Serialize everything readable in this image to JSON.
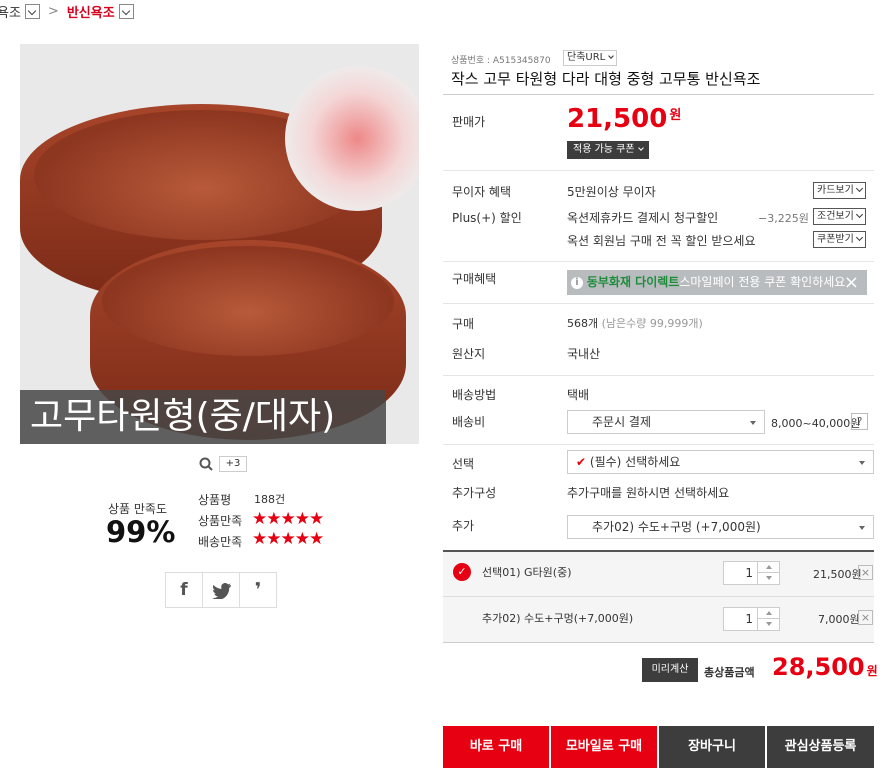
{
  "breadcrumb": {
    "parent": "욕조",
    "current": "반신욕조",
    "separator": ">"
  },
  "image": {
    "overlay_text": "고무타원형(중/대자)",
    "more_count": "+3"
  },
  "rating": {
    "satisfaction_label": "상품 만족도",
    "satisfaction_value": "99%",
    "review_label": "상품평",
    "review_count": "188건",
    "product_label": "상품만족",
    "delivery_label": "배송만족",
    "stars": "★★★★★",
    "product_stars": 5,
    "delivery_stars": 5
  },
  "share": {
    "facebook": "f",
    "twitter": "twitter",
    "other": "❜"
  },
  "product": {
    "number_label": "상품번호 : A515345870",
    "short_url_label": "단축URL",
    "title": "작스 고무 타원형 다라 대형 중형 고무통 반신욕조"
  },
  "price": {
    "label": "판매가",
    "value": "21,500",
    "unit": "원",
    "coupon_btn": "적용 가능 쿠폰"
  },
  "benefits": {
    "free_interest_label": "무이자 혜택",
    "free_interest_text": "5만원이상 무이자",
    "card_btn": "카드보기",
    "plus_label": "Plus(+) 할인",
    "plus_text": "옥션제휴카드 결제시 청구할인",
    "plus_amount": "−3,225원",
    "condition_btn": "조건보기",
    "member_text": "옥션 회원님 구매 전 꼭 할인 받으세요",
    "coupon_receive_btn": "쿠폰받기"
  },
  "purchase_benefit": {
    "label": "구매혜택",
    "banner_highlight": "동부화재 다이렉트",
    "banner_text": "스마일페이 전용 쿠폰 확인하세요"
  },
  "info": {
    "purchase_label": "구매",
    "purchase_value": "568개",
    "remaining": "(남은수량 99,999개)",
    "origin_label": "원산지",
    "origin_value": "국내산"
  },
  "shipping": {
    "method_label": "배송방법",
    "method_value": "택배",
    "fee_label": "배송비",
    "fee_select": "주문시 결제",
    "fee_range": "8,000~40,000원",
    "help": "?"
  },
  "options": {
    "select_label": "선택",
    "select_value": "(필수) 선택하세요",
    "addon_label": "추가구성",
    "addon_text": "추가구매를 원하시면 선택하세요",
    "extra_label": "추가",
    "extra_value": "추가02) 수도+구멍 (+7,000원)"
  },
  "selected": [
    {
      "name": "선택01) G타원(중)",
      "qty": "1",
      "price": "21,500원"
    },
    {
      "name": "추가02) 수도+구멍(+7,000원)",
      "qty": "1",
      "price": "7,000원"
    }
  ],
  "total": {
    "precalc_btn": "미리계산",
    "label": "총상품금액",
    "value": "28,500",
    "unit": "원"
  },
  "actions": {
    "buy": "바로 구매",
    "mobile": "모바일로 구매",
    "cart": "장바구니",
    "wish": "관심상품등록"
  },
  "colors": {
    "accent": "#d6001c",
    "buy_red": "#e60012",
    "dark": "#3d3d3d"
  }
}
